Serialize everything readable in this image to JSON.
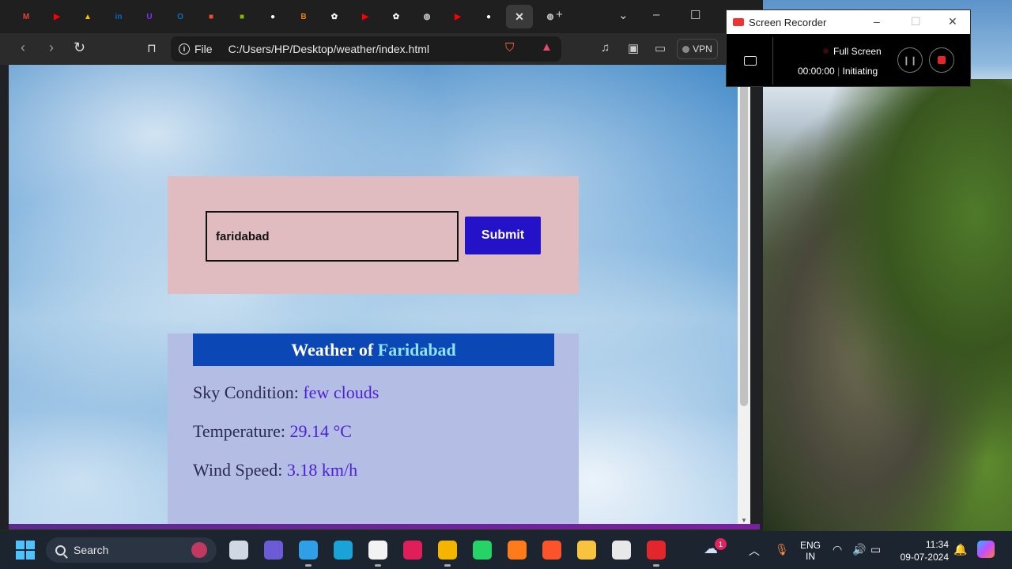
{
  "browser": {
    "address": {
      "scheme_label": "File",
      "url": "C:/Users/HP/Desktop/weather/index.html"
    },
    "tabs": [
      {
        "icon": "gmail-icon",
        "glyph": "M",
        "color": "#ea4335"
      },
      {
        "icon": "youtube-icon",
        "glyph": "▶",
        "color": "#ff0000"
      },
      {
        "icon": "google-drive-icon",
        "glyph": "▲",
        "color": "#fbbc04"
      },
      {
        "icon": "linkedin-icon",
        "glyph": "in",
        "color": "#0a66c2"
      },
      {
        "icon": "unstop-icon",
        "glyph": "U",
        "color": "#7b2ff7"
      },
      {
        "icon": "outlook-icon",
        "glyph": "O",
        "color": "#0f6cbd"
      },
      {
        "icon": "microsoft-icon",
        "glyph": "■",
        "color": "#f25022"
      },
      {
        "icon": "microsoft-icon",
        "glyph": "■",
        "color": "#7fba00"
      },
      {
        "icon": "github-icon",
        "glyph": "●",
        "color": "#ffffff"
      },
      {
        "icon": "blogger-icon",
        "glyph": "B",
        "color": "#f57d00"
      },
      {
        "icon": "chatgpt-icon",
        "glyph": "✿",
        "color": "#ffffff"
      },
      {
        "icon": "youtube-icon",
        "glyph": "▶",
        "color": "#ff0000"
      },
      {
        "icon": "chatgpt-icon",
        "glyph": "✿",
        "color": "#ffffff"
      },
      {
        "icon": "globe-icon",
        "glyph": "◍",
        "color": "#cccccc"
      },
      {
        "icon": "youtube-icon",
        "glyph": "▶",
        "color": "#ff0000"
      },
      {
        "icon": "github-icon",
        "glyph": "●",
        "color": "#ffffff"
      }
    ],
    "vpn_label": "VPN"
  },
  "page": {
    "form": {
      "input_value": "faridabad",
      "submit_label": "Submit"
    },
    "result": {
      "header_prefix": "Weather of ",
      "city": "Faridabad",
      "sky_label": "Sky Condition: ",
      "sky_value": "few clouds",
      "temp_label": "Temperature: ",
      "temp_value": "29.14 °C",
      "wind_label": "Wind Speed: ",
      "wind_value": "3.18 km/h"
    }
  },
  "recorder": {
    "title": "Screen Recorder",
    "mode": "Full Screen",
    "time": "00:00:00",
    "status": "Initiating"
  },
  "taskbar": {
    "search_label": "Search",
    "lang_top": "ENG",
    "lang_bottom": "IN",
    "time": "11:34",
    "date": "09-07-2024",
    "weather_badge": "1",
    "apps": [
      {
        "name": "task-view",
        "color": "#cfd8e3"
      },
      {
        "name": "meet",
        "color": "#6b5bd6"
      },
      {
        "name": "vscode",
        "color": "#2f9fe8"
      },
      {
        "name": "edge",
        "color": "#1aa3d6"
      },
      {
        "name": "notepad",
        "color": "#f3f3f3"
      },
      {
        "name": "slack",
        "color": "#e01e5a"
      },
      {
        "name": "chrome",
        "color": "#f4b400"
      },
      {
        "name": "whatsapp",
        "color": "#25d366"
      },
      {
        "name": "headphones-app",
        "color": "#ff7a1a"
      },
      {
        "name": "brave",
        "color": "#fb542b"
      },
      {
        "name": "file-explorer",
        "color": "#f8c33f"
      },
      {
        "name": "snipping-tool",
        "color": "#e8e8e8"
      },
      {
        "name": "screen-recorder",
        "color": "#e3262b"
      }
    ]
  },
  "colors": {
    "form_bg": "#e0bcc1",
    "result_bg": "#b4bde3",
    "header_bg": "#0c47b6",
    "submit_bg": "#2412c8",
    "value_color": "#4a1fd6"
  }
}
